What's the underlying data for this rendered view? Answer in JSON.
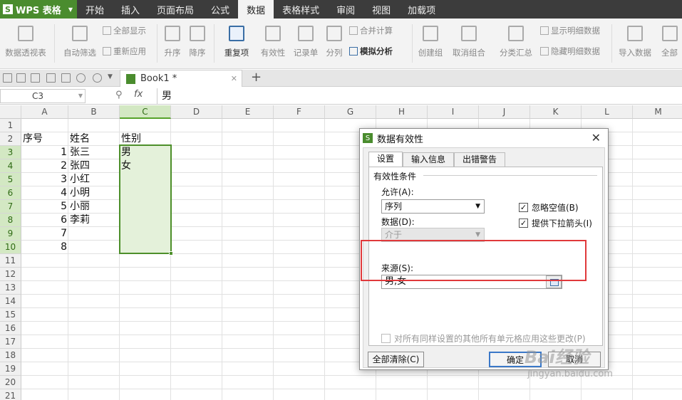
{
  "app": {
    "name": "WPS 表格"
  },
  "menu": {
    "tabs": [
      {
        "label": "开始",
        "active": false
      },
      {
        "label": "插入",
        "active": false
      },
      {
        "label": "页面布局",
        "active": false
      },
      {
        "label": "公式",
        "active": false
      },
      {
        "label": "数据",
        "active": true
      },
      {
        "label": "表格样式",
        "active": false
      },
      {
        "label": "审阅",
        "active": false
      },
      {
        "label": "视图",
        "active": false
      },
      {
        "label": "加载项",
        "active": false
      }
    ]
  },
  "ribbon": {
    "pivot": "数据透视表",
    "autofilter": "自动筛选",
    "show_all": "全部显示",
    "reapply": "重新应用",
    "sort_asc": "升序",
    "sort_desc": "降序",
    "dup": "重复项",
    "validation": "有效性",
    "form": "记录单",
    "split": "分列",
    "consolidate": "合并计算",
    "whatif": "模拟分析",
    "group": "创建组",
    "ungroup": "取消组合",
    "subtotal": "分类汇总",
    "show_detail": "显示明细数据",
    "hide_detail": "隐藏明细数据",
    "import": "导入数据",
    "all": "全部"
  },
  "doc_tab": {
    "title": "Book1 *"
  },
  "formula_bar": {
    "name_box": "C3",
    "formula": "男"
  },
  "grid": {
    "columns": [
      "A",
      "B",
      "C",
      "D",
      "E",
      "F",
      "G",
      "H",
      "I",
      "J",
      "K",
      "L",
      "M"
    ],
    "rows": [
      "1",
      "2",
      "3",
      "4",
      "5",
      "6",
      "7",
      "8",
      "9",
      "10",
      "11",
      "12",
      "13",
      "14",
      "15",
      "16",
      "17",
      "18",
      "19",
      "20",
      "21"
    ],
    "headers": {
      "seq": "序号",
      "name": "姓名",
      "gender": "性别"
    },
    "data": [
      {
        "seq": "1",
        "name": "张三",
        "gender": "男"
      },
      {
        "seq": "2",
        "name": "张四",
        "gender": "女"
      },
      {
        "seq": "3",
        "name": "小红",
        "gender": ""
      },
      {
        "seq": "4",
        "name": "小明",
        "gender": ""
      },
      {
        "seq": "5",
        "name": "小丽",
        "gender": ""
      },
      {
        "seq": "6",
        "name": "李莉",
        "gender": ""
      },
      {
        "seq": "7",
        "name": "",
        "gender": ""
      },
      {
        "seq": "8",
        "name": "",
        "gender": ""
      }
    ]
  },
  "dialog": {
    "title": "数据有效性",
    "tabs": [
      "设置",
      "输入信息",
      "出错警告"
    ],
    "group": "有效性条件",
    "allow_label": "允许(A):",
    "allow_value": "序列",
    "data_label": "数据(D):",
    "data_value": "介于",
    "ignore_blank": "忽略空值(B)",
    "dropdown": "提供下拉箭头(I)",
    "source_label": "来源(S):",
    "source_value": "男,女",
    "apply_all": "对所有同样设置的其他所有单元格应用这些更改(P)",
    "clear_btn": "全部清除(C)",
    "ok_btn": "确定",
    "cancel_btn": "取消"
  },
  "watermark": {
    "text": "Bai经验",
    "sub": "jingyan.baidu.com"
  }
}
